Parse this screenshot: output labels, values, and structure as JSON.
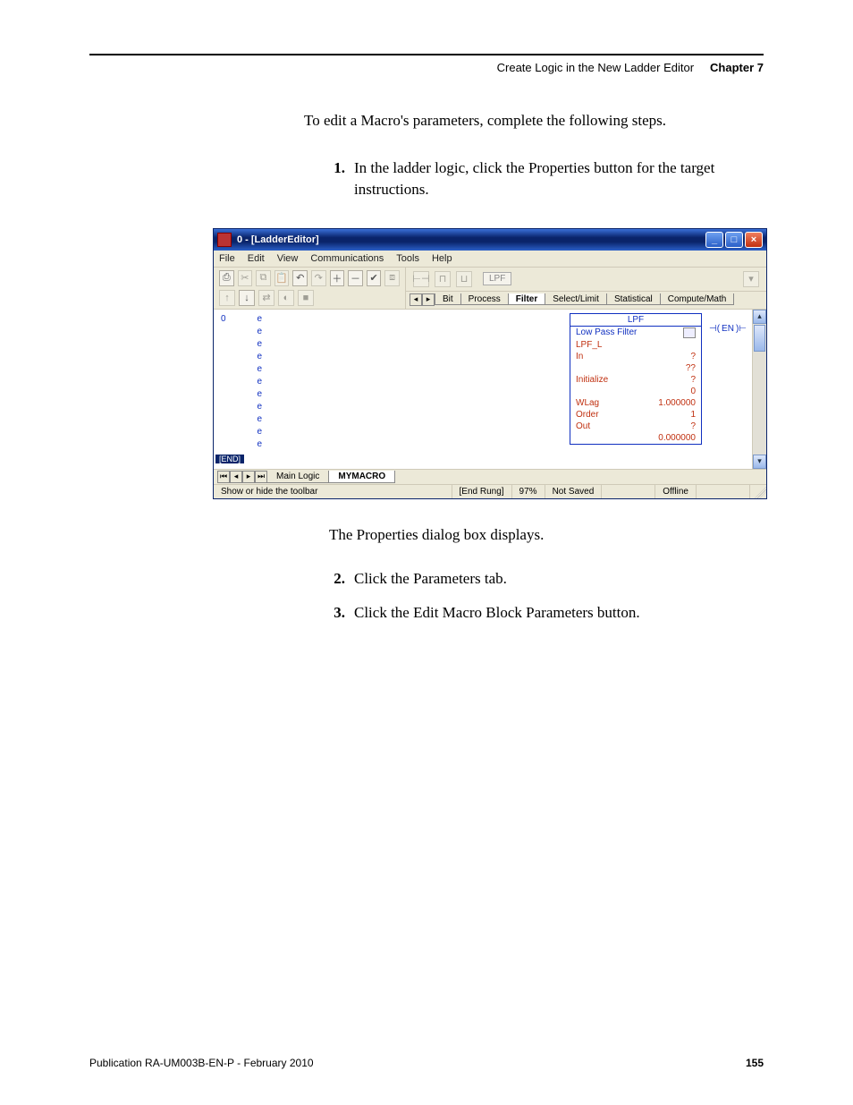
{
  "header": {
    "section": "Create Logic in the New Ladder Editor",
    "chapter": "Chapter 7"
  },
  "intro": "To edit a Macro's parameters, complete the following steps.",
  "steps_top": [
    {
      "num": "1.",
      "text": "In the ladder logic, click the Properties button for the target instructions."
    }
  ],
  "caption": "The Properties dialog box displays.",
  "steps_bottom": [
    {
      "num": "2.",
      "text": "Click the Parameters tab."
    },
    {
      "num": "3.",
      "text": "Click the Edit Macro Block Parameters button."
    }
  ],
  "window": {
    "title": "0 - [LadderEditor]",
    "menus": [
      "File",
      "Edit",
      "View",
      "Communications",
      "Tools",
      "Help"
    ],
    "element_label": "LPF",
    "category_tabs": [
      "Bit",
      "Process",
      "Filter",
      "Select/Limit",
      "Statistical",
      "Compute/Math"
    ],
    "active_category": "Filter",
    "rung_index": "0",
    "end_label": "[END]",
    "lpf_block": {
      "header": "LPF",
      "subtitle": "Low Pass Filter",
      "rows": [
        {
          "k": "LPF_L",
          "v": ""
        },
        {
          "k": "In",
          "v": "?"
        },
        {
          "k": "",
          "v": "??"
        },
        {
          "k": "Initialize",
          "v": "?"
        },
        {
          "k": "",
          "v": "0"
        },
        {
          "k": "WLag",
          "v": "1.000000"
        },
        {
          "k": "Order",
          "v": "1"
        },
        {
          "k": "Out",
          "v": "?"
        },
        {
          "k": "",
          "v": "0.000000"
        }
      ],
      "en": "EN"
    },
    "bottom_tabs": [
      "Main Logic",
      "MYMACRO"
    ],
    "active_bottom_tab": "MYMACRO",
    "status": {
      "hint": "Show or hide the toolbar",
      "rung": "[End Rung]",
      "zoom": "97%",
      "save": "Not Saved",
      "conn": "Offline"
    }
  },
  "footer": {
    "pub": "Publication RA-UM003B-EN-P - February 2010",
    "page": "155"
  }
}
